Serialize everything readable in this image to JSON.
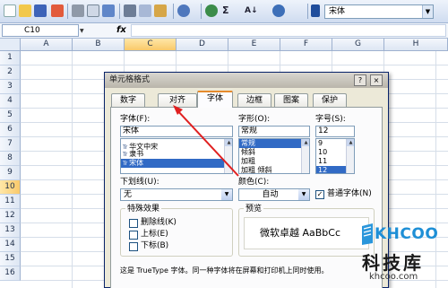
{
  "toolbar": {
    "font_name": "宋体",
    "icons": [
      "new-icon",
      "open-icon",
      "save-icon",
      "permission-icon",
      "print-icon",
      "print-preview-icon",
      "spellcheck-icon",
      "cut-icon",
      "copy-icon",
      "paste-icon",
      "undo-icon",
      "hyperlink-icon",
      "autosum-icon",
      "sort-icon",
      "help-icon",
      "font-icon"
    ],
    "autosum_glyph": "Σ",
    "sort_glyph": "A↓"
  },
  "formula_bar": {
    "name_box": "C10",
    "fx_label": "fx",
    "value": ""
  },
  "grid": {
    "columns": [
      "A",
      "B",
      "C",
      "D",
      "E",
      "F",
      "G",
      "H"
    ],
    "rows": [
      "1",
      "2",
      "3",
      "4",
      "5",
      "6",
      "7",
      "8",
      "9",
      "10",
      "11",
      "12",
      "13",
      "14",
      "15",
      "16"
    ],
    "selected_column": "C",
    "selected_row": "10"
  },
  "dialog": {
    "title": "单元格格式",
    "help_glyph": "?",
    "close_glyph": "×",
    "tabs": [
      "数字",
      "对齐",
      "字体",
      "边框",
      "图案",
      "保护"
    ],
    "active_tab": "字体",
    "font_label": "字体(F):",
    "font_value": "宋体",
    "font_list": [
      "华文中宋",
      "隶书",
      "宋体"
    ],
    "style_label": "字形(O):",
    "style_value": "常规",
    "style_list": [
      "常规",
      "倾斜",
      "加粗",
      "加粗 倾斜"
    ],
    "size_label": "字号(S):",
    "size_value": "12",
    "size_list": [
      "9",
      "10",
      "11",
      "12"
    ],
    "underline_label": "下划线(U):",
    "underline_value": "无",
    "color_label": "颜色(C):",
    "color_value": "自动",
    "normal_font_label": "普通字体(N)",
    "normal_font_checked": true,
    "effects_title": "特殊效果",
    "effects": [
      "删除线(K)",
      "上标(E)",
      "下标(B)"
    ],
    "preview_title": "预览",
    "preview_text": "微软卓越  AaBbCc",
    "footer": "这是 TrueType 字体。同一种字体将在屏幕和打印机上同时使用。"
  },
  "watermark": {
    "logo": "KHCOO",
    "chinese": "科技库",
    "url": "khcoo.com"
  },
  "colors": {
    "accent": "#316ac5",
    "selected_header": "#f9c96a",
    "arrow": "#e02020",
    "watermark_blue": "#1e8fd6"
  }
}
